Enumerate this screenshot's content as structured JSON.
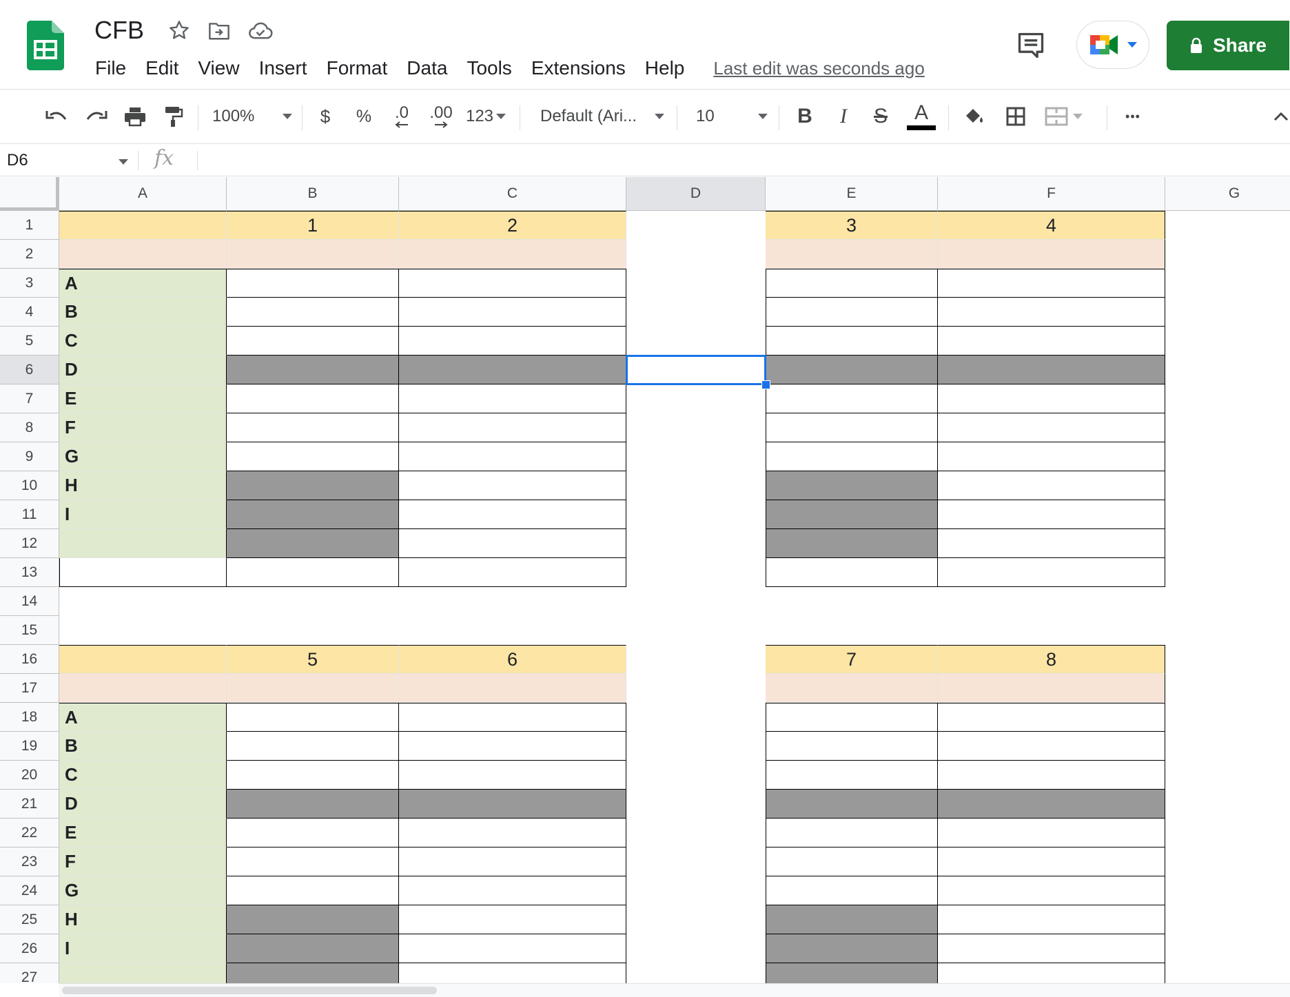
{
  "app": {
    "title": "CFB",
    "last_edit": "Last edit was seconds ago",
    "share_label": "Share",
    "brand_color": "#0f9d58",
    "share_color": "#1e7e34"
  },
  "menu": [
    "File",
    "Edit",
    "View",
    "Insert",
    "Format",
    "Data",
    "Tools",
    "Extensions",
    "Help"
  ],
  "toolbar": {
    "zoom": "100%",
    "currency": "$",
    "percent": "%",
    "decrease_decimal": ".0",
    "increase_decimal": ".00",
    "more_formats": "123",
    "font": "Default (Ari...",
    "font_size": "10",
    "bold": "B",
    "italic": "I",
    "strikethrough": "S",
    "text_color": "A",
    "more": "•••"
  },
  "formula_bar": {
    "name_box": "D6",
    "fx": "fx",
    "value": ""
  },
  "grid": {
    "columns": [
      "A",
      "B",
      "C",
      "D",
      "E",
      "F",
      "G"
    ],
    "selected_column": "D",
    "rows": [
      "1",
      "2",
      "3",
      "4",
      "5",
      "6",
      "7",
      "8",
      "9",
      "10",
      "11",
      "12",
      "13",
      "14",
      "15",
      "16",
      "17",
      "18",
      "19",
      "20",
      "21",
      "22",
      "23",
      "24",
      "25",
      "26",
      "27"
    ],
    "selected_row": "6",
    "selected_cell": "D6",
    "colors": {
      "header_yellow": "#fce5a5",
      "subheader_peach": "#f8e4d6",
      "label_green": "#dfeacf",
      "blocked_gray": "#999999"
    },
    "blocks": [
      {
        "header_row": 1,
        "numbers": [
          "1",
          "2",
          "3",
          "4"
        ],
        "labels": [
          "A",
          "B",
          "C",
          "D",
          "E",
          "F",
          "G",
          "H",
          "I",
          ""
        ],
        "table_end_row": 13
      },
      {
        "header_row": 16,
        "numbers": [
          "5",
          "6",
          "7",
          "8"
        ],
        "labels": [
          "A",
          "B",
          "C",
          "D",
          "E",
          "F",
          "G",
          "H",
          "I",
          ""
        ],
        "table_end_row": 27
      }
    ]
  }
}
